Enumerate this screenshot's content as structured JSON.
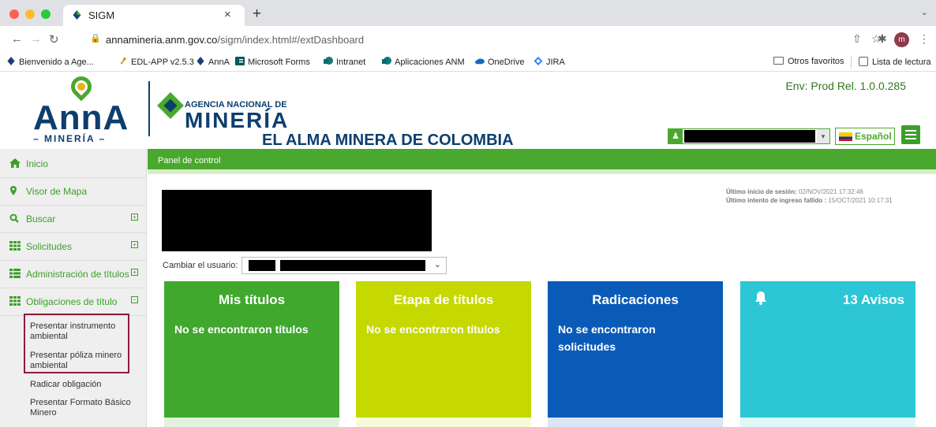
{
  "browser": {
    "tab_title": "SIGM",
    "tab_close": "×",
    "new_tab": "+",
    "tab_search": "⌄",
    "url_host": "annamineria.anm.gov.co",
    "url_path": "/sigm/index.html#/extDashboard",
    "profile_initial": "m",
    "bookmarks": [
      {
        "label": "Bienvenido a Age...",
        "icon": "anm-diamond-icon",
        "color": "#1b3f7a"
      },
      {
        "label": "EDL-APP v2.5.3",
        "icon": "edl-icon",
        "color": "#c99a2e"
      },
      {
        "label": "AnnA",
        "icon": "anm-diamond-icon",
        "color": "#1b3f7a"
      },
      {
        "label": "Microsoft Forms",
        "icon": "forms-icon",
        "color": "#035a58"
      },
      {
        "label": "Intranet",
        "icon": "sharepoint-icon",
        "color": "#117a78"
      },
      {
        "label": "Aplicaciones ANM",
        "icon": "sharepoint-icon",
        "color": "#117a78"
      },
      {
        "label": "OneDrive",
        "icon": "onedrive-icon",
        "color": "#0f6cbd"
      },
      {
        "label": "JIRA",
        "icon": "jira-icon",
        "color": "#2684ff"
      }
    ],
    "other_favorites": "Otros favoritos",
    "reading_list": "Lista de lectura"
  },
  "header": {
    "env": "Env: Prod Rel. 1.0.0.285",
    "logo_word": "AnnA",
    "logo_sub": "– MINERÍA –",
    "agency_top": "AGENCIA NACIONAL DE",
    "agency_main": "MINERÍA",
    "tagline": "EL ALMA MINERA DE COLOMBIA",
    "language": "Español",
    "language_caret": "⌄"
  },
  "sidebar": {
    "items": [
      {
        "label": "Inicio",
        "icon": "home-icon"
      },
      {
        "label": "Visor de Mapa",
        "icon": "map-pin-icon"
      },
      {
        "label": "Buscar",
        "icon": "search-icon",
        "expand": "+"
      },
      {
        "label": "Solicitudes",
        "icon": "grid-icon",
        "expand": "+"
      },
      {
        "label": "Administración de títulos",
        "icon": "list-icon",
        "expand": "+"
      },
      {
        "label": "Obligaciones de título",
        "icon": "grid-icon",
        "expand": "−"
      }
    ],
    "subitems": [
      "Presentar instrumento ambiental",
      "Presentar póliza minero ambiental",
      "Radicar obligación",
      "Presentar Formato Básico Minero"
    ]
  },
  "main": {
    "panel_title": "Panel de control",
    "last_login_label": "Último inicio de sesión:",
    "last_login_value": "02/NOV/2021 17:32:46",
    "last_failed_label": "Último intento de ingreso fallido :",
    "last_failed_value": "15/OCT/2021 10:17:31",
    "change_user_label": "Cambiar el usuario:",
    "cards": [
      {
        "title": "Mis títulos",
        "text": "No se encontraron títulos",
        "color": "#3fa82d"
      },
      {
        "title": "Etapa de títulos",
        "text": "No se encontraron títulos",
        "color": "#c5d900"
      },
      {
        "title": "Radicaciones",
        "text": "No se encontraron solicitudes",
        "color": "#0a5bb8"
      },
      {
        "title": "13 Avisos",
        "text": "",
        "color": "#2cc6d6"
      }
    ]
  }
}
